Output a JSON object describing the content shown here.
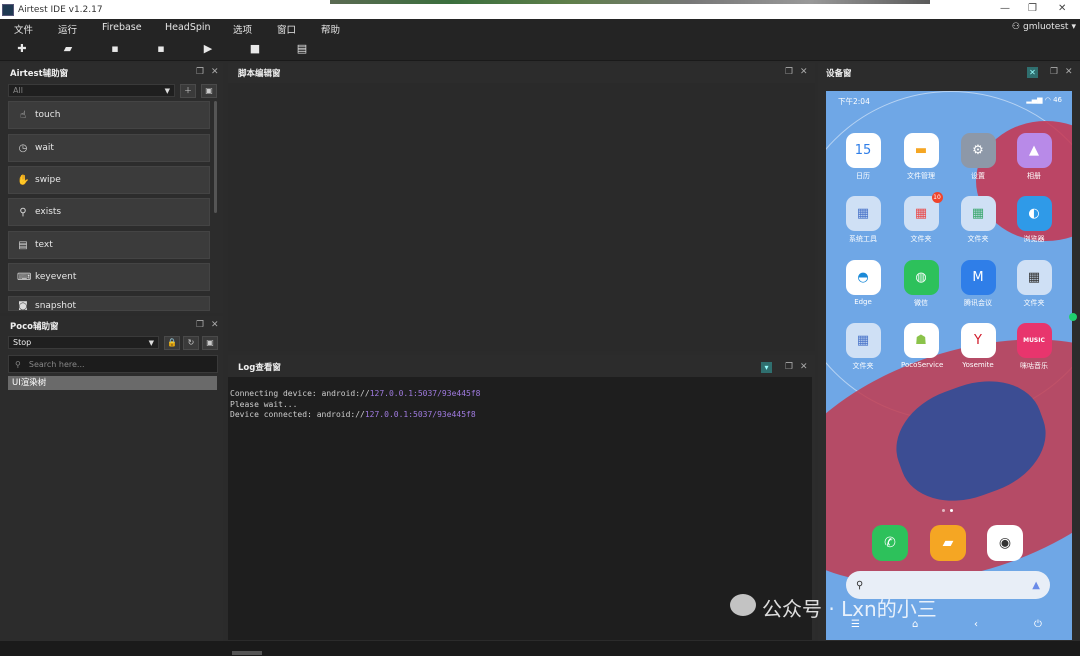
{
  "window": {
    "title": "Airtest IDE v1.2.17",
    "controls": [
      "—",
      "❐",
      "✕"
    ]
  },
  "menu": {
    "items": [
      "文件",
      "运行",
      "Firebase",
      "HeadSpin",
      "选项",
      "窗口",
      "帮助"
    ],
    "user": "gmluotest"
  },
  "toolbar": {
    "buttons": [
      "new",
      "open",
      "save",
      "save-as",
      "run",
      "stop",
      "log"
    ]
  },
  "airtest_panel": {
    "title": "Airtest辅助窗",
    "filter_value": "All",
    "items": [
      {
        "label": "touch",
        "icon": "touch-icon"
      },
      {
        "label": "wait",
        "icon": "clock-icon"
      },
      {
        "label": "swipe",
        "icon": "swipe-icon"
      },
      {
        "label": "exists",
        "icon": "magnifier-icon"
      },
      {
        "label": "text",
        "icon": "text-icon"
      },
      {
        "label": "keyevent",
        "icon": "keyboard-icon"
      },
      {
        "label": "snapshot",
        "icon": "camera-icon"
      }
    ]
  },
  "poco_panel": {
    "title": "Poco辅助窗",
    "mode_value": "Stop",
    "search_placeholder": "Search here...",
    "tree_root": "UI渲染树"
  },
  "editor_panel": {
    "title": "脚本编辑窗"
  },
  "log_panel": {
    "title": "Log查看窗",
    "lines": [
      {
        "prefix": "Connecting device: android://",
        "link": "127.0.0.1:5037/93e445f8"
      },
      {
        "prefix": "Please wait...",
        "link": ""
      },
      {
        "prefix": "Device connected: android://",
        "link": "127.0.0.1:5037/93e445f8"
      }
    ]
  },
  "device_panel": {
    "title": "设备窗",
    "status_time": "下午2:04",
    "status_right": "46",
    "apps": [
      {
        "label": "日历",
        "glyph": "15",
        "color": "#ffffff",
        "text_color": "#2f7ee8"
      },
      {
        "label": "文件管理",
        "glyph": "▬",
        "color": "#ffffff",
        "text_color": "#f5a623"
      },
      {
        "label": "设置",
        "glyph": "⚙",
        "color": "#8d98a8",
        "text_color": "#ffffff"
      },
      {
        "label": "相册",
        "glyph": "▲",
        "color": "#b88ae8",
        "text_color": "#ffffff"
      },
      {
        "label": "系统工具",
        "glyph": "▦",
        "color": "#cfe0f5",
        "text_color": "#4a74c9"
      },
      {
        "label": "文件夹",
        "glyph": "▦",
        "color": "#cfe0f5",
        "text_color": "#e94b4b",
        "badge": "10"
      },
      {
        "label": "文件夹",
        "glyph": "▦",
        "color": "#cfe0f5",
        "text_color": "#3aa76d"
      },
      {
        "label": "浏览器",
        "glyph": "◐",
        "color": "#2f9ae8",
        "text_color": "#ffffff"
      },
      {
        "label": "Edge",
        "glyph": "◓",
        "color": "#ffffff",
        "text_color": "#1b8ad8"
      },
      {
        "label": "微信",
        "glyph": "◍",
        "color": "#2dc15b",
        "text_color": "#ffffff"
      },
      {
        "label": "腾讯会议",
        "glyph": "M",
        "color": "#2f7ee8",
        "text_color": "#ffffff"
      },
      {
        "label": "文件夹",
        "glyph": "▦",
        "color": "#cfe0f5",
        "text_color": "#333333"
      },
      {
        "label": "文件夹",
        "glyph": "▦",
        "color": "#cfe0f5",
        "text_color": "#4a74c9"
      },
      {
        "label": "PocoService",
        "glyph": "☗",
        "color": "#ffffff",
        "text_color": "#8bc34a"
      },
      {
        "label": "Yosemite",
        "glyph": "Y",
        "color": "#ffffff",
        "text_color": "#d11a2a"
      },
      {
        "label": "咪咕音乐",
        "glyph": "MUSIC",
        "color": "#e8356d",
        "text_color": "#ffffff"
      }
    ],
    "dock": [
      {
        "name": "phone",
        "glyph": "✆",
        "color": "#2dc15b"
      },
      {
        "name": "messages",
        "glyph": "▰",
        "color": "#f5a623"
      },
      {
        "name": "camera",
        "glyph": "◉",
        "color": "#ffffff"
      }
    ],
    "search_glyph": "🔍"
  },
  "watermark": "公众号 · Lxn的小三"
}
